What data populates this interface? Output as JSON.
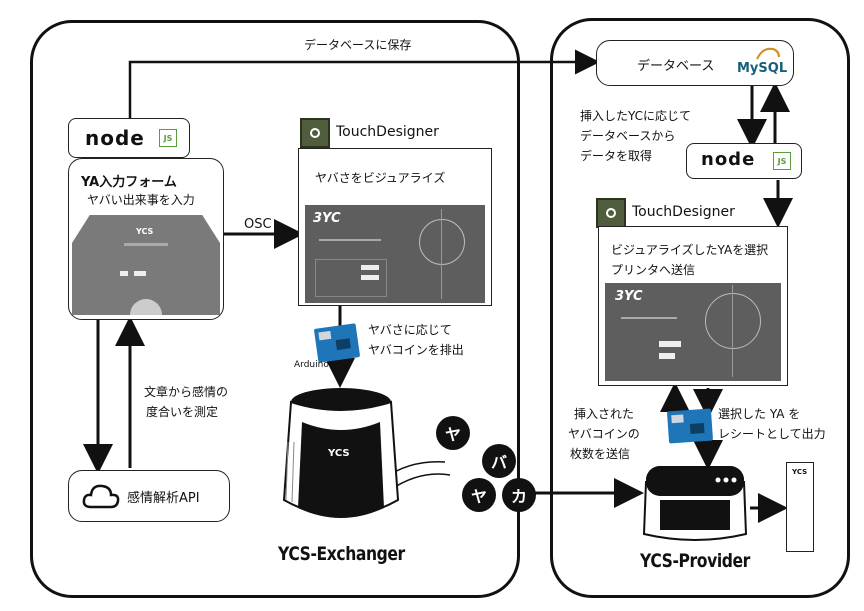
{
  "left_panel": {
    "title": "YCS-Exchanger",
    "save_to_db": "データベースに保存",
    "node_logo": "node",
    "node_badge": "JS",
    "form": {
      "title": "YA入力フォーム",
      "subtitle": "ヤバい出来事を入力",
      "screen_title": "YCS"
    },
    "osc": "OSC",
    "td_label": "TouchDesigner",
    "td_caption": "ヤバさをビジュアライズ",
    "td_screen_big": "3YC",
    "arduino_label": "Arduino",
    "arduino_caption_1": "ヤバさに応じて",
    "arduino_caption_2": "ヤバコインを排出",
    "sentiment_caption_1": "文章から感情の",
    "sentiment_caption_2": "度合いを測定",
    "api_label": "感情解析API",
    "machine_label": "YCS"
  },
  "coins": [
    "ヤ",
    "バ",
    "ヤ",
    "カ"
  ],
  "right_panel": {
    "title": "YCS-Provider",
    "db_label": "データベース",
    "mysql": "MySQL",
    "caption_1": "挿入したYCに応じて",
    "caption_2": "データベースから",
    "caption_3": "データを取得",
    "node_logo": "node",
    "node_badge": "JS",
    "td_label": "TouchDesigner",
    "td_caption_1": "ビジュアライズしたYAを選択",
    "td_caption_2": "プリンタへ送信",
    "td_screen_big": "3YC",
    "coins_caption_1": "挿入された",
    "coins_caption_2": "ヤバコインの",
    "coins_caption_3": "枚数を送信",
    "printer_caption_1": "選択した YA を",
    "printer_caption_2": "レシートとして出力",
    "receipt_label": "YCS"
  }
}
